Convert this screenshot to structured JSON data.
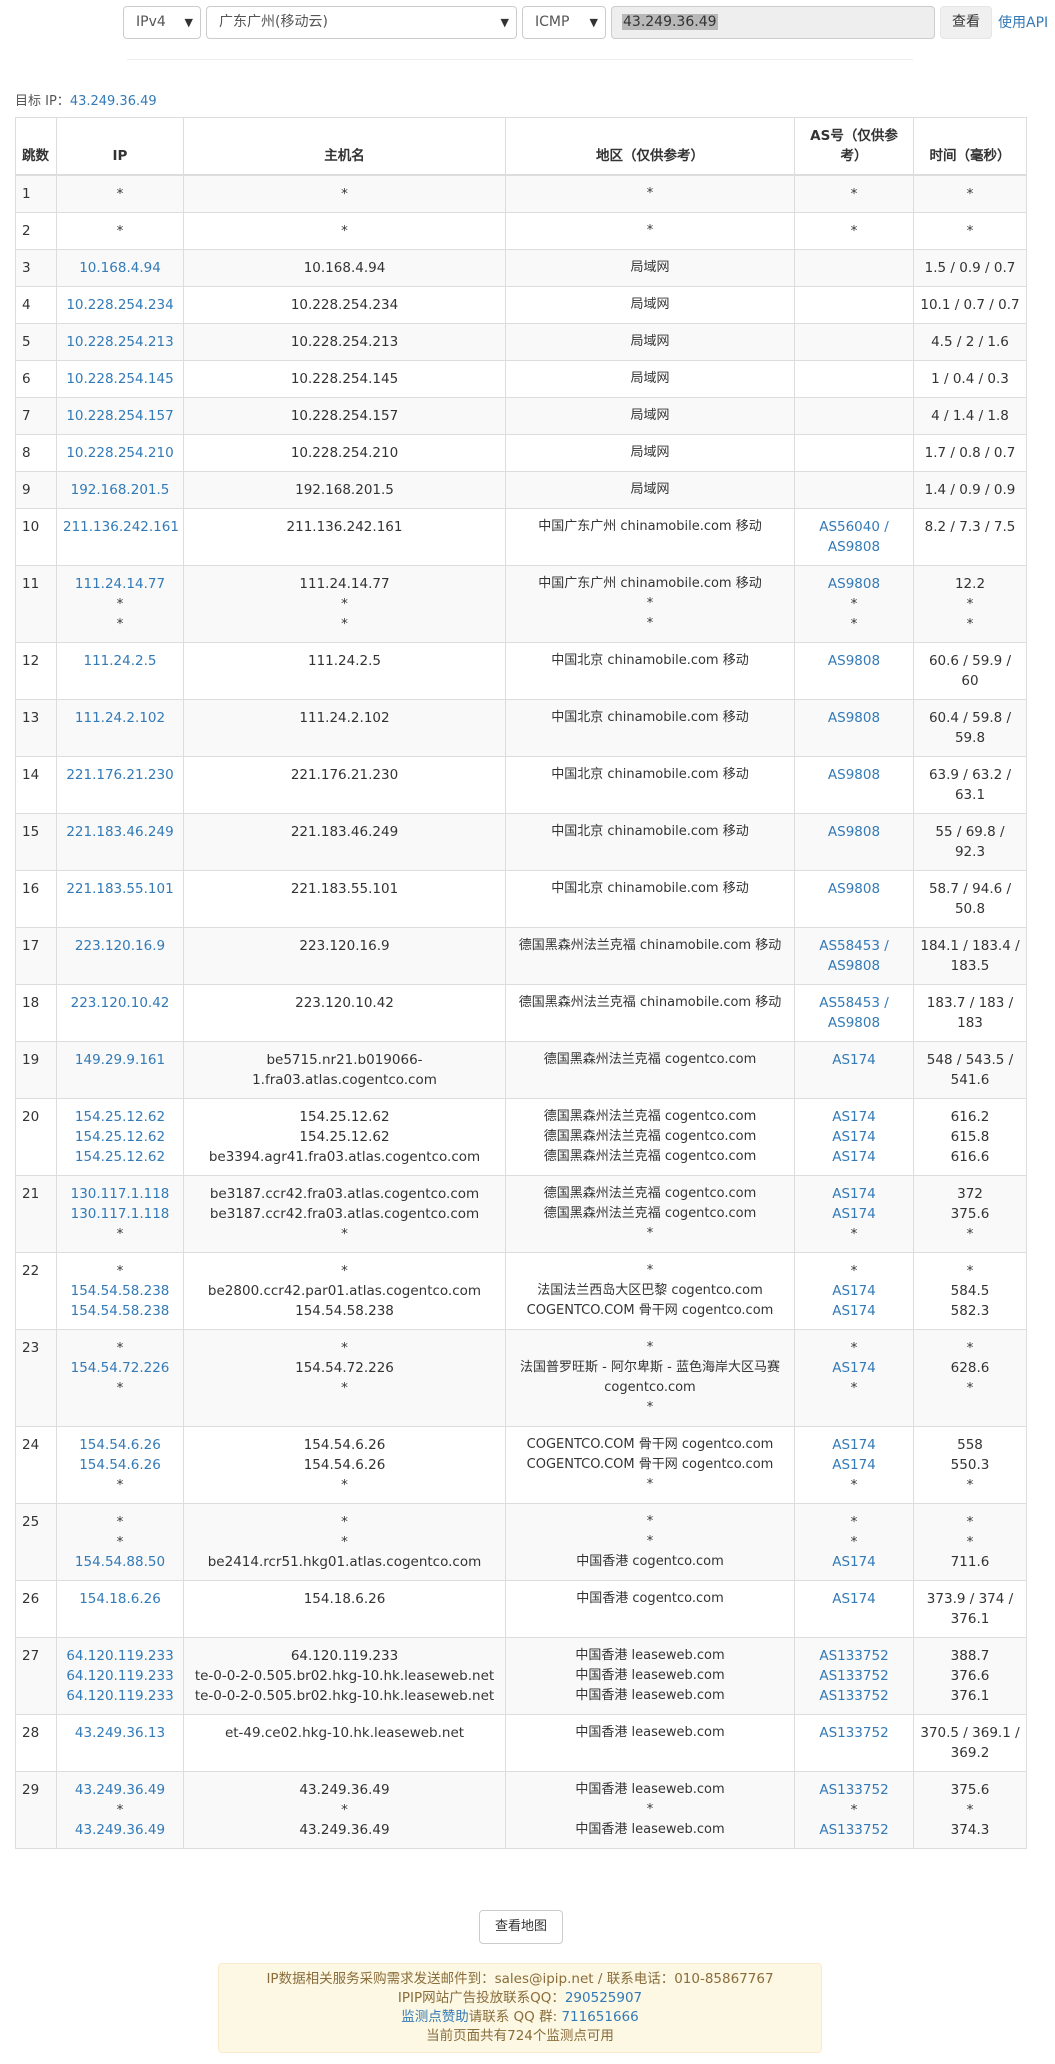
{
  "toolbar": {
    "ip_version": "IPv4",
    "node": "广东广州(移动云)",
    "protocol": "ICMP",
    "target_value": "43.249.36.49",
    "query_label": "查看",
    "api_label": "使用API"
  },
  "target": {
    "label": "目标 IP：",
    "ip": "43.249.36.49"
  },
  "table": {
    "headers": {
      "hop": "跳数",
      "ip": "IP",
      "host": "主机名",
      "region": "地区（仅供参考）",
      "as": "AS号（仅供参考）",
      "time": "时间（毫秒）"
    },
    "rows": [
      {
        "hop": "1",
        "lines": [
          {
            "ip": "*",
            "host": "*",
            "region": "*",
            "as": "*",
            "time": "*"
          }
        ]
      },
      {
        "hop": "2",
        "lines": [
          {
            "ip": "*",
            "host": "*",
            "region": "*",
            "as": "*",
            "time": "*"
          }
        ]
      },
      {
        "hop": "3",
        "lines": [
          {
            "ip": "10.168.4.94",
            "host": "10.168.4.94",
            "region": "局域网",
            "as": "",
            "time": "1.5 / 0.9 / 0.7"
          }
        ]
      },
      {
        "hop": "4",
        "lines": [
          {
            "ip": "10.228.254.234",
            "host": "10.228.254.234",
            "region": "局域网",
            "as": "",
            "time": "10.1 / 0.7 / 0.7"
          }
        ]
      },
      {
        "hop": "5",
        "lines": [
          {
            "ip": "10.228.254.213",
            "host": "10.228.254.213",
            "region": "局域网",
            "as": "",
            "time": "4.5 / 2 / 1.6"
          }
        ]
      },
      {
        "hop": "6",
        "lines": [
          {
            "ip": "10.228.254.145",
            "host": "10.228.254.145",
            "region": "局域网",
            "as": "",
            "time": "1 / 0.4 / 0.3"
          }
        ]
      },
      {
        "hop": "7",
        "lines": [
          {
            "ip": "10.228.254.157",
            "host": "10.228.254.157",
            "region": "局域网",
            "as": "",
            "time": "4 / 1.4 / 1.8"
          }
        ]
      },
      {
        "hop": "8",
        "lines": [
          {
            "ip": "10.228.254.210",
            "host": "10.228.254.210",
            "region": "局域网",
            "as": "",
            "time": "1.7 / 0.8 / 0.7"
          }
        ]
      },
      {
        "hop": "9",
        "lines": [
          {
            "ip": "192.168.201.5",
            "host": "192.168.201.5",
            "region": "局域网",
            "as": "",
            "time": "1.4 / 0.9 / 0.9"
          }
        ]
      },
      {
        "hop": "10",
        "lines": [
          {
            "ip": "211.136.242.161",
            "host": "211.136.242.161",
            "region": "中国广东广州 chinamobile.com 移动",
            "as": "AS56040 / AS9808",
            "time": "8.2 / 7.3 / 7.5"
          }
        ]
      },
      {
        "hop": "11",
        "lines": [
          {
            "ip": "111.24.14.77",
            "host": "111.24.14.77",
            "region": "中国广东广州 chinamobile.com 移动",
            "as": "AS9808",
            "time": "12.2"
          },
          {
            "ip": "*",
            "host": "*",
            "region": "*",
            "as": "*",
            "time": "*"
          },
          {
            "ip": "*",
            "host": "*",
            "region": "*",
            "as": "*",
            "time": "*"
          }
        ]
      },
      {
        "hop": "12",
        "lines": [
          {
            "ip": "111.24.2.5",
            "host": "111.24.2.5",
            "region": "中国北京 chinamobile.com 移动",
            "as": "AS9808",
            "time": "60.6 / 59.9 / 60"
          }
        ]
      },
      {
        "hop": "13",
        "lines": [
          {
            "ip": "111.24.2.102",
            "host": "111.24.2.102",
            "region": "中国北京 chinamobile.com 移动",
            "as": "AS9808",
            "time": "60.4 / 59.8 / 59.8"
          }
        ]
      },
      {
        "hop": "14",
        "lines": [
          {
            "ip": "221.176.21.230",
            "host": "221.176.21.230",
            "region": "中国北京 chinamobile.com 移动",
            "as": "AS9808",
            "time": "63.9 / 63.2 / 63.1"
          }
        ]
      },
      {
        "hop": "15",
        "lines": [
          {
            "ip": "221.183.46.249",
            "host": "221.183.46.249",
            "region": "中国北京 chinamobile.com 移动",
            "as": "AS9808",
            "time": "55 / 69.8 / 92.3"
          }
        ]
      },
      {
        "hop": "16",
        "lines": [
          {
            "ip": "221.183.55.101",
            "host": "221.183.55.101",
            "region": "中国北京 chinamobile.com 移动",
            "as": "AS9808",
            "time": "58.7 / 94.6 / 50.8"
          }
        ]
      },
      {
        "hop": "17",
        "lines": [
          {
            "ip": "223.120.16.9",
            "host": "223.120.16.9",
            "region": "德国黑森州法兰克福 chinamobile.com 移动",
            "as": "AS58453 / AS9808",
            "time": "184.1 / 183.4 / 183.5"
          }
        ]
      },
      {
        "hop": "18",
        "lines": [
          {
            "ip": "223.120.10.42",
            "host": "223.120.10.42",
            "region": "德国黑森州法兰克福 chinamobile.com 移动",
            "as": "AS58453 / AS9808",
            "time": "183.7 / 183 / 183"
          }
        ]
      },
      {
        "hop": "19",
        "lines": [
          {
            "ip": "149.29.9.161",
            "host": "be5715.nr21.b019066-1.fra03.atlas.cogentco.com",
            "region": "德国黑森州法兰克福 cogentco.com",
            "as": "AS174",
            "time": "548 / 543.5 / 541.6"
          }
        ]
      },
      {
        "hop": "20",
        "lines": [
          {
            "ip": "154.25.12.62",
            "host": "154.25.12.62",
            "region": "德国黑森州法兰克福 cogentco.com",
            "as": "AS174",
            "time": "616.2"
          },
          {
            "ip": "154.25.12.62",
            "host": "154.25.12.62",
            "region": "德国黑森州法兰克福 cogentco.com",
            "as": "AS174",
            "time": "615.8"
          },
          {
            "ip": "154.25.12.62",
            "host": "be3394.agr41.fra03.atlas.cogentco.com",
            "region": "德国黑森州法兰克福 cogentco.com",
            "as": "AS174",
            "time": "616.6"
          }
        ]
      },
      {
        "hop": "21",
        "lines": [
          {
            "ip": "130.117.1.118",
            "host": "be3187.ccr42.fra03.atlas.cogentco.com",
            "region": "德国黑森州法兰克福 cogentco.com",
            "as": "AS174",
            "time": "372"
          },
          {
            "ip": "130.117.1.118",
            "host": "be3187.ccr42.fra03.atlas.cogentco.com",
            "region": "德国黑森州法兰克福 cogentco.com",
            "as": "AS174",
            "time": "375.6"
          },
          {
            "ip": "*",
            "host": "*",
            "region": "*",
            "as": "*",
            "time": "*"
          }
        ]
      },
      {
        "hop": "22",
        "lines": [
          {
            "ip": "*",
            "host": "*",
            "region": "*",
            "as": "*",
            "time": "*"
          },
          {
            "ip": "154.54.58.238",
            "host": "be2800.ccr42.par01.atlas.cogentco.com",
            "region": "法国法兰西岛大区巴黎 cogentco.com",
            "as": "AS174",
            "time": "584.5"
          },
          {
            "ip": "154.54.58.238",
            "host": "154.54.58.238",
            "region": "COGENTCO.COM 骨干网 cogentco.com",
            "as": "AS174",
            "time": "582.3"
          }
        ]
      },
      {
        "hop": "23",
        "lines": [
          {
            "ip": "*",
            "host": "*",
            "region": "*",
            "as": "*",
            "time": "*"
          },
          {
            "ip": "154.54.72.226",
            "host": "154.54.72.226",
            "region": "法国普罗旺斯 - 阿尔卑斯 - 蓝色海岸大区马赛 cogentco.com",
            "as": "AS174",
            "time": "628.6"
          },
          {
            "ip": "*",
            "host": "*",
            "region": "*",
            "as": "*",
            "time": "*"
          }
        ]
      },
      {
        "hop": "24",
        "lines": [
          {
            "ip": "154.54.6.26",
            "host": "154.54.6.26",
            "region": "COGENTCO.COM 骨干网 cogentco.com",
            "as": "AS174",
            "time": "558"
          },
          {
            "ip": "154.54.6.26",
            "host": "154.54.6.26",
            "region": "COGENTCO.COM 骨干网 cogentco.com",
            "as": "AS174",
            "time": "550.3"
          },
          {
            "ip": "*",
            "host": "*",
            "region": "*",
            "as": "*",
            "time": "*"
          }
        ]
      },
      {
        "hop": "25",
        "lines": [
          {
            "ip": "*",
            "host": "*",
            "region": "*",
            "as": "*",
            "time": "*"
          },
          {
            "ip": "*",
            "host": "*",
            "region": "*",
            "as": "*",
            "time": "*"
          },
          {
            "ip": "154.54.88.50",
            "host": "be2414.rcr51.hkg01.atlas.cogentco.com",
            "region": "中国香港 cogentco.com",
            "as": "AS174",
            "time": "711.6"
          }
        ]
      },
      {
        "hop": "26",
        "lines": [
          {
            "ip": "154.18.6.26",
            "host": "154.18.6.26",
            "region": "中国香港 cogentco.com",
            "as": "AS174",
            "time": "373.9 / 374 / 376.1"
          }
        ]
      },
      {
        "hop": "27",
        "lines": [
          {
            "ip": "64.120.119.233",
            "host": "64.120.119.233",
            "region": "中国香港 leaseweb.com",
            "as": "AS133752",
            "time": "388.7"
          },
          {
            "ip": "64.120.119.233",
            "host": "te-0-0-2-0.505.br02.hkg-10.hk.leaseweb.net",
            "region": "中国香港 leaseweb.com",
            "as": "AS133752",
            "time": "376.6"
          },
          {
            "ip": "64.120.119.233",
            "host": "te-0-0-2-0.505.br02.hkg-10.hk.leaseweb.net",
            "region": "中国香港 leaseweb.com",
            "as": "AS133752",
            "time": "376.1"
          }
        ]
      },
      {
        "hop": "28",
        "lines": [
          {
            "ip": "43.249.36.13",
            "host": "et-49.ce02.hkg-10.hk.leaseweb.net",
            "region": "中国香港 leaseweb.com",
            "as": "AS133752",
            "time": "370.5 / 369.1 / 369.2"
          }
        ]
      },
      {
        "hop": "29",
        "lines": [
          {
            "ip": "43.249.36.49",
            "host": "43.249.36.49",
            "region": "中国香港 leaseweb.com",
            "as": "AS133752",
            "time": "375.6"
          },
          {
            "ip": "*",
            "host": "*",
            "region": "*",
            "as": "*",
            "time": "*"
          },
          {
            "ip": "43.249.36.49",
            "host": "43.249.36.49",
            "region": "中国香港 leaseweb.com",
            "as": "AS133752",
            "time": "374.3"
          }
        ]
      }
    ]
  },
  "map_button": "查看地图",
  "notice": {
    "line1": "IP数据相关服务采购需求发送邮件到：sales@ipip.net / 联系电话：010-85867767",
    "line2_prefix": "IPIP网站广告投放联系QQ：",
    "line2_link": "290525907",
    "line3_link": "监测点赞助",
    "line3_mid": "请联系 QQ 群: ",
    "line3_group": "711651666",
    "line4": "当前页面共有724个监测点可用"
  },
  "colors": {
    "link": "#337ab7",
    "notice_bg": "#fcf8e3",
    "notice_text": "#8a6d3b"
  }
}
